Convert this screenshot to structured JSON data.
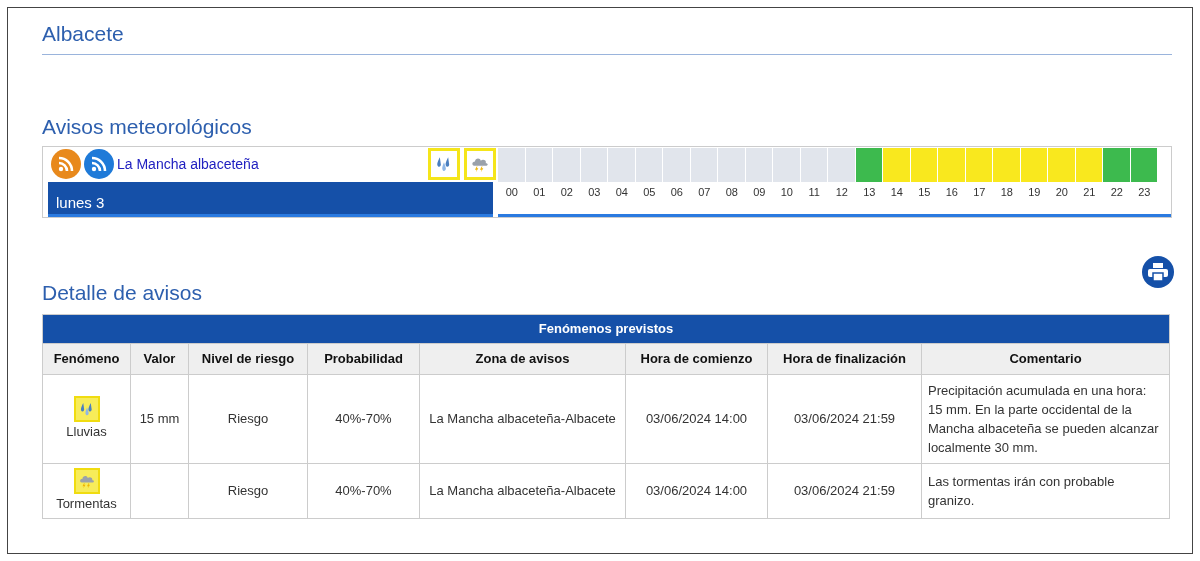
{
  "title": "Albacete",
  "warnings": {
    "title": "Avisos meteorológicos",
    "zone": "La Mancha albaceteña",
    "day": "lunes 3",
    "phenomena": [
      {
        "kind": "rain"
      },
      {
        "kind": "storm"
      }
    ],
    "hours": [
      {
        "label": "00",
        "color": "#e1e5ec"
      },
      {
        "label": "01",
        "color": "#e1e5ec"
      },
      {
        "label": "02",
        "color": "#e1e5ec"
      },
      {
        "label": "03",
        "color": "#e1e5ec"
      },
      {
        "label": "04",
        "color": "#e1e5ec"
      },
      {
        "label": "05",
        "color": "#e1e5ec"
      },
      {
        "label": "06",
        "color": "#e1e5ec"
      },
      {
        "label": "07",
        "color": "#e1e5ec"
      },
      {
        "label": "08",
        "color": "#e1e5ec"
      },
      {
        "label": "09",
        "color": "#e1e5ec"
      },
      {
        "label": "10",
        "color": "#e1e5ec"
      },
      {
        "label": "11",
        "color": "#e1e5ec"
      },
      {
        "label": "12",
        "color": "#e1e5ec"
      },
      {
        "label": "13",
        "color": "#3dba4e"
      },
      {
        "label": "14",
        "color": "#f9e81e"
      },
      {
        "label": "15",
        "color": "#f9e81e"
      },
      {
        "label": "16",
        "color": "#f9e81e"
      },
      {
        "label": "17",
        "color": "#f9e81e"
      },
      {
        "label": "18",
        "color": "#f9e81e"
      },
      {
        "label": "19",
        "color": "#f9e81e"
      },
      {
        "label": "20",
        "color": "#f9e81e"
      },
      {
        "label": "21",
        "color": "#f9e81e"
      },
      {
        "label": "22",
        "color": "#3dba4e"
      },
      {
        "label": "23",
        "color": "#3dba4e"
      }
    ]
  },
  "detail": {
    "title": "Detalle de avisos",
    "table_title": "Fenómenos previstos",
    "columns": [
      "Fenómeno",
      "Valor",
      "Nivel de riesgo",
      "Probabilidad",
      "Zona de avisos",
      "Hora de comienzo",
      "Hora de finalización",
      "Comentario"
    ],
    "rows": [
      {
        "kind": "rain",
        "phenomenon": "Lluvias",
        "value": "15 mm",
        "risk": "Riesgo",
        "probability": "40%-70%",
        "zone": "La Mancha albaceteña-Albacete",
        "start": "03/06/2024 14:00",
        "end": "03/06/2024 21:59",
        "comment": "Precipitación acumulada en una hora: 15 mm. En la parte occidental de la Mancha albaceteña se pueden alcanzar localmente 30 mm."
      },
      {
        "kind": "storm",
        "phenomenon": "Tormentas",
        "risk": "Riesgo",
        "probability": "40%-70%",
        "zone": "La Mancha albaceteña-Albacete",
        "start": "03/06/2024 14:00",
        "end": "03/06/2024 21:59",
        "comment": "Las tormentas irán con probable granizo."
      }
    ]
  }
}
